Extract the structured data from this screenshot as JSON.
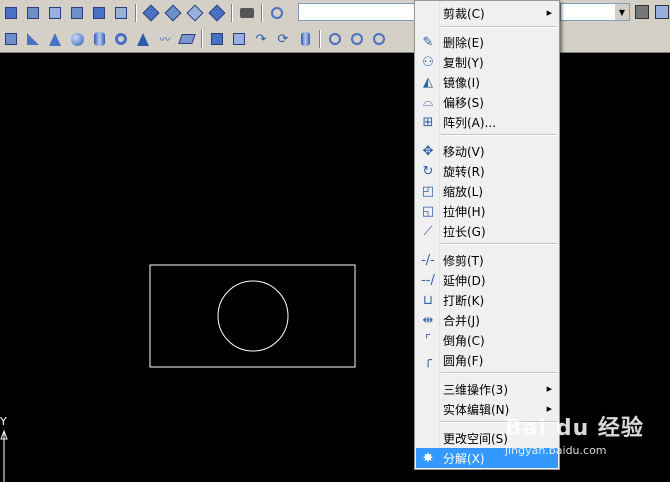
{
  "context_menu": {
    "items": [
      {
        "label": "剪裁(C)",
        "icon": "none",
        "submenu": true
      },
      {
        "label": "删除(E)",
        "icon": "eraser-icon"
      },
      {
        "label": "复制(Y)",
        "icon": "copy-icon"
      },
      {
        "label": "镜像(I)",
        "icon": "mirror-icon"
      },
      {
        "label": "偏移(S)",
        "icon": "offset-icon"
      },
      {
        "label": "阵列(A)...",
        "icon": "array-icon"
      },
      {
        "label": "移动(V)",
        "icon": "move-icon"
      },
      {
        "label": "旋转(R)",
        "icon": "rotate-icon"
      },
      {
        "label": "缩放(L)",
        "icon": "scale-icon"
      },
      {
        "label": "拉伸(H)",
        "icon": "stretch-icon"
      },
      {
        "label": "拉长(G)",
        "icon": "lengthen-icon"
      },
      {
        "label": "修剪(T)",
        "icon": "trim-icon"
      },
      {
        "label": "延伸(D)",
        "icon": "extend-icon"
      },
      {
        "label": "打断(K)",
        "icon": "break-icon"
      },
      {
        "label": "合并(J)",
        "icon": "join-icon"
      },
      {
        "label": "倒角(C)",
        "icon": "chamfer-icon"
      },
      {
        "label": "圆角(F)",
        "icon": "fillet-icon"
      },
      {
        "label": "三维操作(3)",
        "icon": "none",
        "submenu": true
      },
      {
        "label": "实体编辑(N)",
        "icon": "none",
        "submenu": true
      },
      {
        "label": "更改空间(S)",
        "icon": "none"
      },
      {
        "label": "分解(X)",
        "icon": "explode-icon",
        "highlighted": true
      }
    ]
  },
  "axis": {
    "y_label": "Y"
  },
  "watermark": {
    "brand": "Bai du 经验",
    "url": "jingyan.baidu.com"
  },
  "colors": {
    "menu_highlight": "#3399ff",
    "canvas": "#000000",
    "drawing": "#ffffff"
  }
}
